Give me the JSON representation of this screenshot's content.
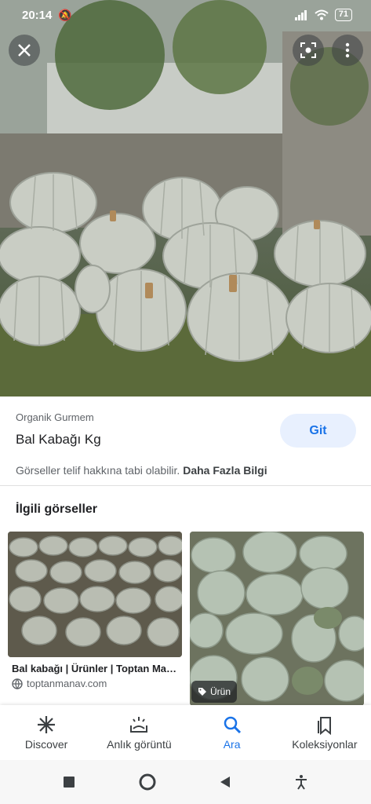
{
  "status_bar": {
    "time": "20:14",
    "battery": "71"
  },
  "viewer": {
    "close_icon": "close-icon",
    "lens_icon": "lens-icon",
    "menu_icon": "more-vertical-icon"
  },
  "result": {
    "source": "Organik Gurmem",
    "title": "Bal Kabağı Kg",
    "visit_label": "Git",
    "copyright_text": "Görseller telif hakkına tabi olabilir.",
    "more_info_label": "Daha Fazla Bilgi"
  },
  "related": {
    "heading": "İlgili görseller",
    "items": [
      {
        "title": "Bal kabağı | Ürünler | Toptan Man...",
        "site": "toptanmanav.com"
      },
      {
        "badge": "Ürün"
      }
    ]
  },
  "bottom_nav": {
    "items": [
      {
        "label": "Discover",
        "icon": "asterisk-icon"
      },
      {
        "label": "Anlık görüntü",
        "icon": "snapshot-icon"
      },
      {
        "label": "Ara",
        "icon": "search-icon"
      },
      {
        "label": "Koleksiyonlar",
        "icon": "collections-icon"
      }
    ],
    "active": "Ara"
  },
  "system_nav": {
    "icons": [
      "recents-icon",
      "home-icon",
      "back-icon",
      "accessibility-icon"
    ]
  },
  "colors": {
    "accent": "#1a73e8",
    "accent_bg": "#e8f0fe",
    "pumpkin": "#c9cdc4"
  }
}
